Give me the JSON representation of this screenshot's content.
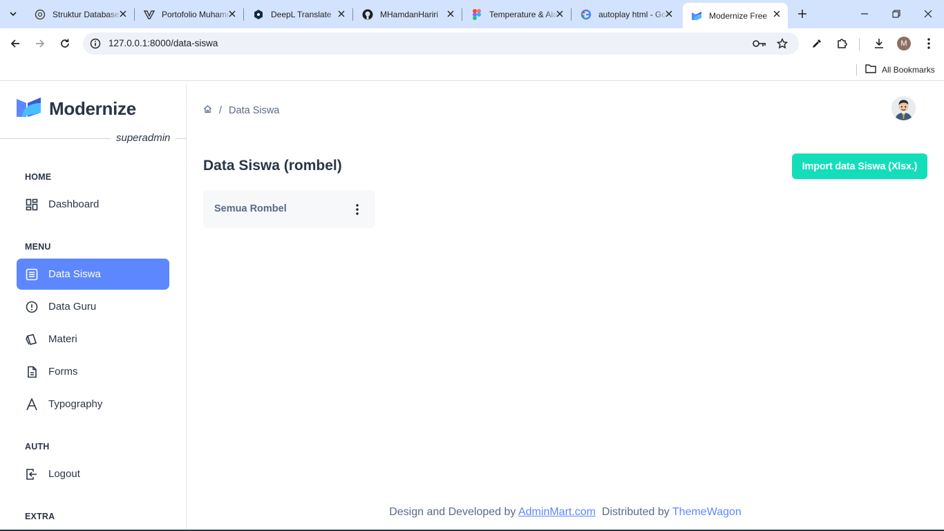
{
  "browser": {
    "tabs": [
      {
        "title": "Struktur Database",
        "icon": "openai-icon"
      },
      {
        "title": "Portofolio Muhammad",
        "icon": "vercel-icon"
      },
      {
        "title": "DeepL Translate",
        "icon": "deepl-icon"
      },
      {
        "title": "MHamdanHariri",
        "icon": "github-icon"
      },
      {
        "title": "Temperature & Alat",
        "icon": "figma-icon"
      },
      {
        "title": "autoplay html - Google",
        "icon": "google-icon"
      },
      {
        "title": "Modernize Free",
        "icon": "modernize-icon"
      }
    ],
    "url": "127.0.0.1:8000/data-siswa",
    "profile_initial": "M",
    "bookmarks_label": "All Bookmarks"
  },
  "sidebar": {
    "brand": "Modernize",
    "role": "superadmin",
    "sections": {
      "home": "HOME",
      "menu": "MENU",
      "auth": "AUTH",
      "extra": "EXTRA"
    },
    "items": {
      "dashboard": "Dashboard",
      "data_siswa": "Data Siswa",
      "data_guru": "Data Guru",
      "materi": "Materi",
      "forms": "Forms",
      "typography": "Typography",
      "logout": "Logout"
    },
    "accent": "#5d87ff"
  },
  "main": {
    "breadcrumb": "Data Siswa",
    "title": "Data Siswa (rombel)",
    "import_button": "Import data Siswa (Xlsx.)",
    "import_color": "#13deb9",
    "rombel_card": "Semua Rombel"
  },
  "footer": {
    "prefix": "Design and Developed by",
    "link1": "AdminMart.com",
    "middle": "Distributed by",
    "link2": "ThemeWagon"
  }
}
